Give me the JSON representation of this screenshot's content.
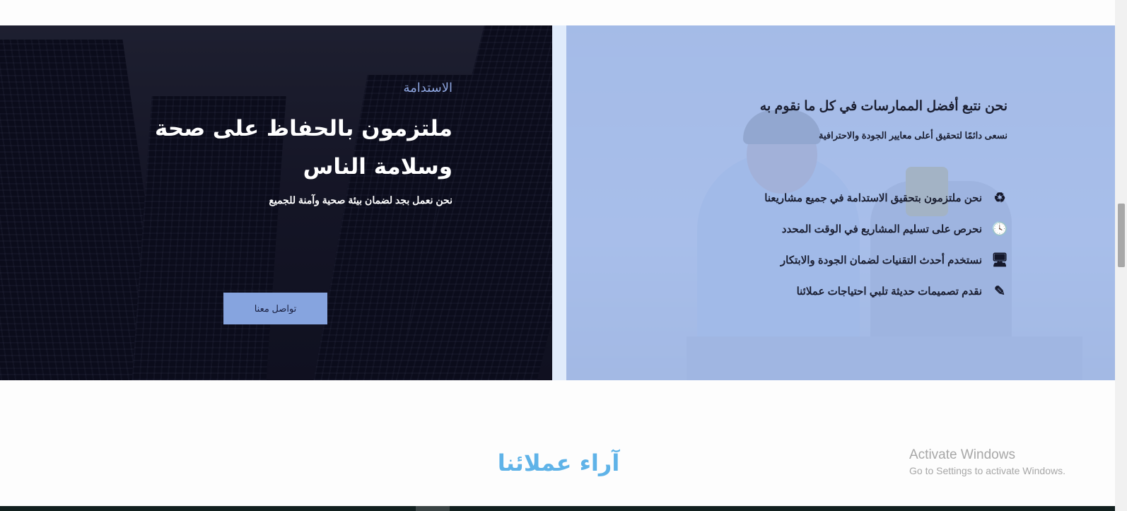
{
  "sustainability": {
    "kicker": "الاستدامة",
    "headline": "ملتزمون بالحفاظ على صحة وسلامة الناس",
    "lead": "نحن نعمل بجد لضمان بيئة صحية وآمنة للجميع",
    "cta_label": "تواصل معنا"
  },
  "practices": {
    "title": "نحن نتبع أفضل الممارسات في كل ما نقوم به",
    "subtitle": "نسعى دائمًا لتحقيق أعلى معايير الجودة والاحترافية",
    "features": [
      {
        "label": "نحن ملتزمون بتحقيق الاستدامة في جميع مشاريعنا",
        "icon": "recycle-icon",
        "glyph": "♻"
      },
      {
        "label": "نحرص على تسليم المشاريع في الوقت المحدد",
        "icon": "clock-icon",
        "glyph": "🕓"
      },
      {
        "label": "نستخدم أحدث التقنيات لضمان الجودة والابتكار",
        "icon": "monitor-icon",
        "glyph": "🖥"
      },
      {
        "label": "نقدم تصميمات حديثة تلبي احتياجات عملائنا",
        "icon": "design-tools-icon",
        "glyph": "✎"
      }
    ]
  },
  "testimonials": {
    "title": "آراء عملائنا"
  },
  "watermark": {
    "title": "Activate Windows",
    "subtitle": "Go to Settings to activate Windows."
  },
  "colors": {
    "accent_blue": "#86a4df",
    "heading_blue": "#5fb3e8",
    "dark_panel": "#141521"
  }
}
